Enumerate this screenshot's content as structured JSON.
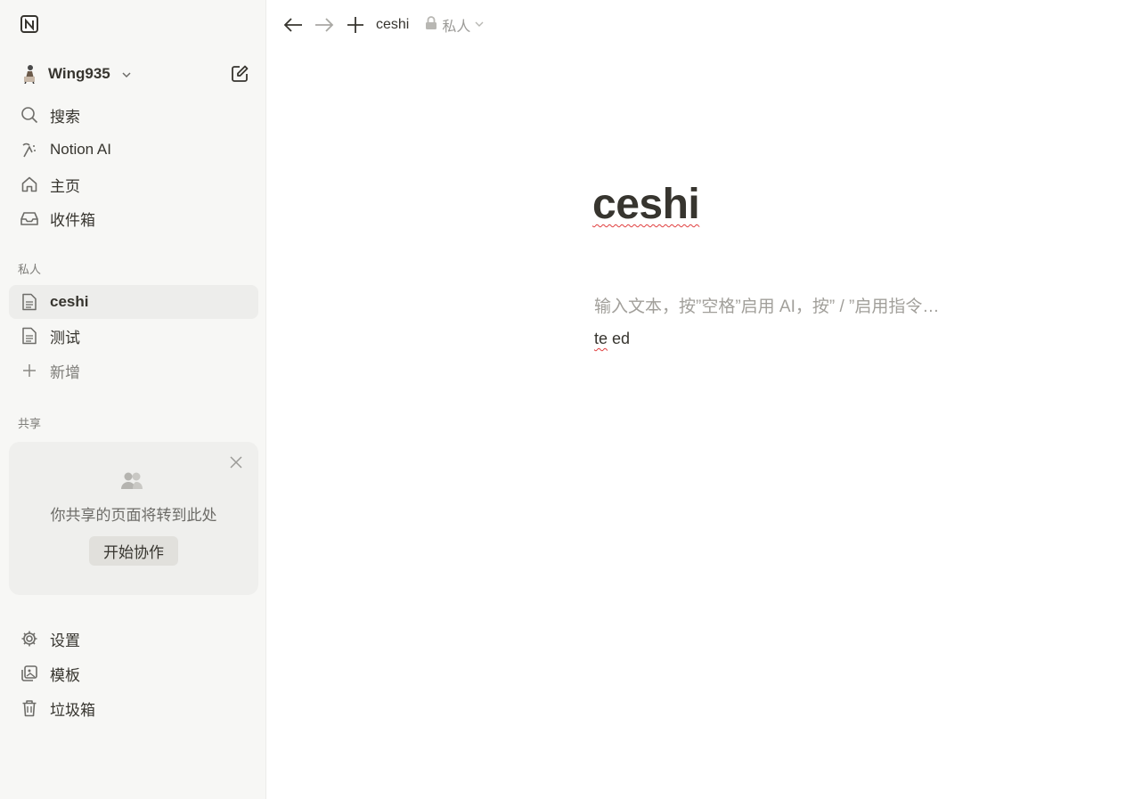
{
  "sidebar": {
    "workspace_name": "Wing935",
    "nav": [
      {
        "label": "搜索",
        "icon": "search-icon"
      },
      {
        "label": "Notion AI",
        "icon": "notion-ai-icon"
      },
      {
        "label": "主页",
        "icon": "home-icon"
      },
      {
        "label": "收件箱",
        "icon": "inbox-icon"
      }
    ],
    "private_label": "私人",
    "pages": [
      {
        "label": "ceshi",
        "active": true
      },
      {
        "label": "测试",
        "active": false
      }
    ],
    "add_label": "新增",
    "shared_label": "共享",
    "share_card": {
      "text": "你共享的页面将转到此处",
      "button": "开始协作"
    },
    "bottom": [
      {
        "label": "设置",
        "icon": "gear-icon"
      },
      {
        "label": "模板",
        "icon": "templates-icon"
      },
      {
        "label": "垃圾箱",
        "icon": "trash-icon"
      }
    ]
  },
  "topbar": {
    "breadcrumb": "ceshi",
    "privacy": "私人"
  },
  "page": {
    "title": "ceshi",
    "placeholder": "输入文本，按”空格”启用 AI，按” / ”启用指令…",
    "body_word1": "te",
    "body_word2": " ed"
  }
}
